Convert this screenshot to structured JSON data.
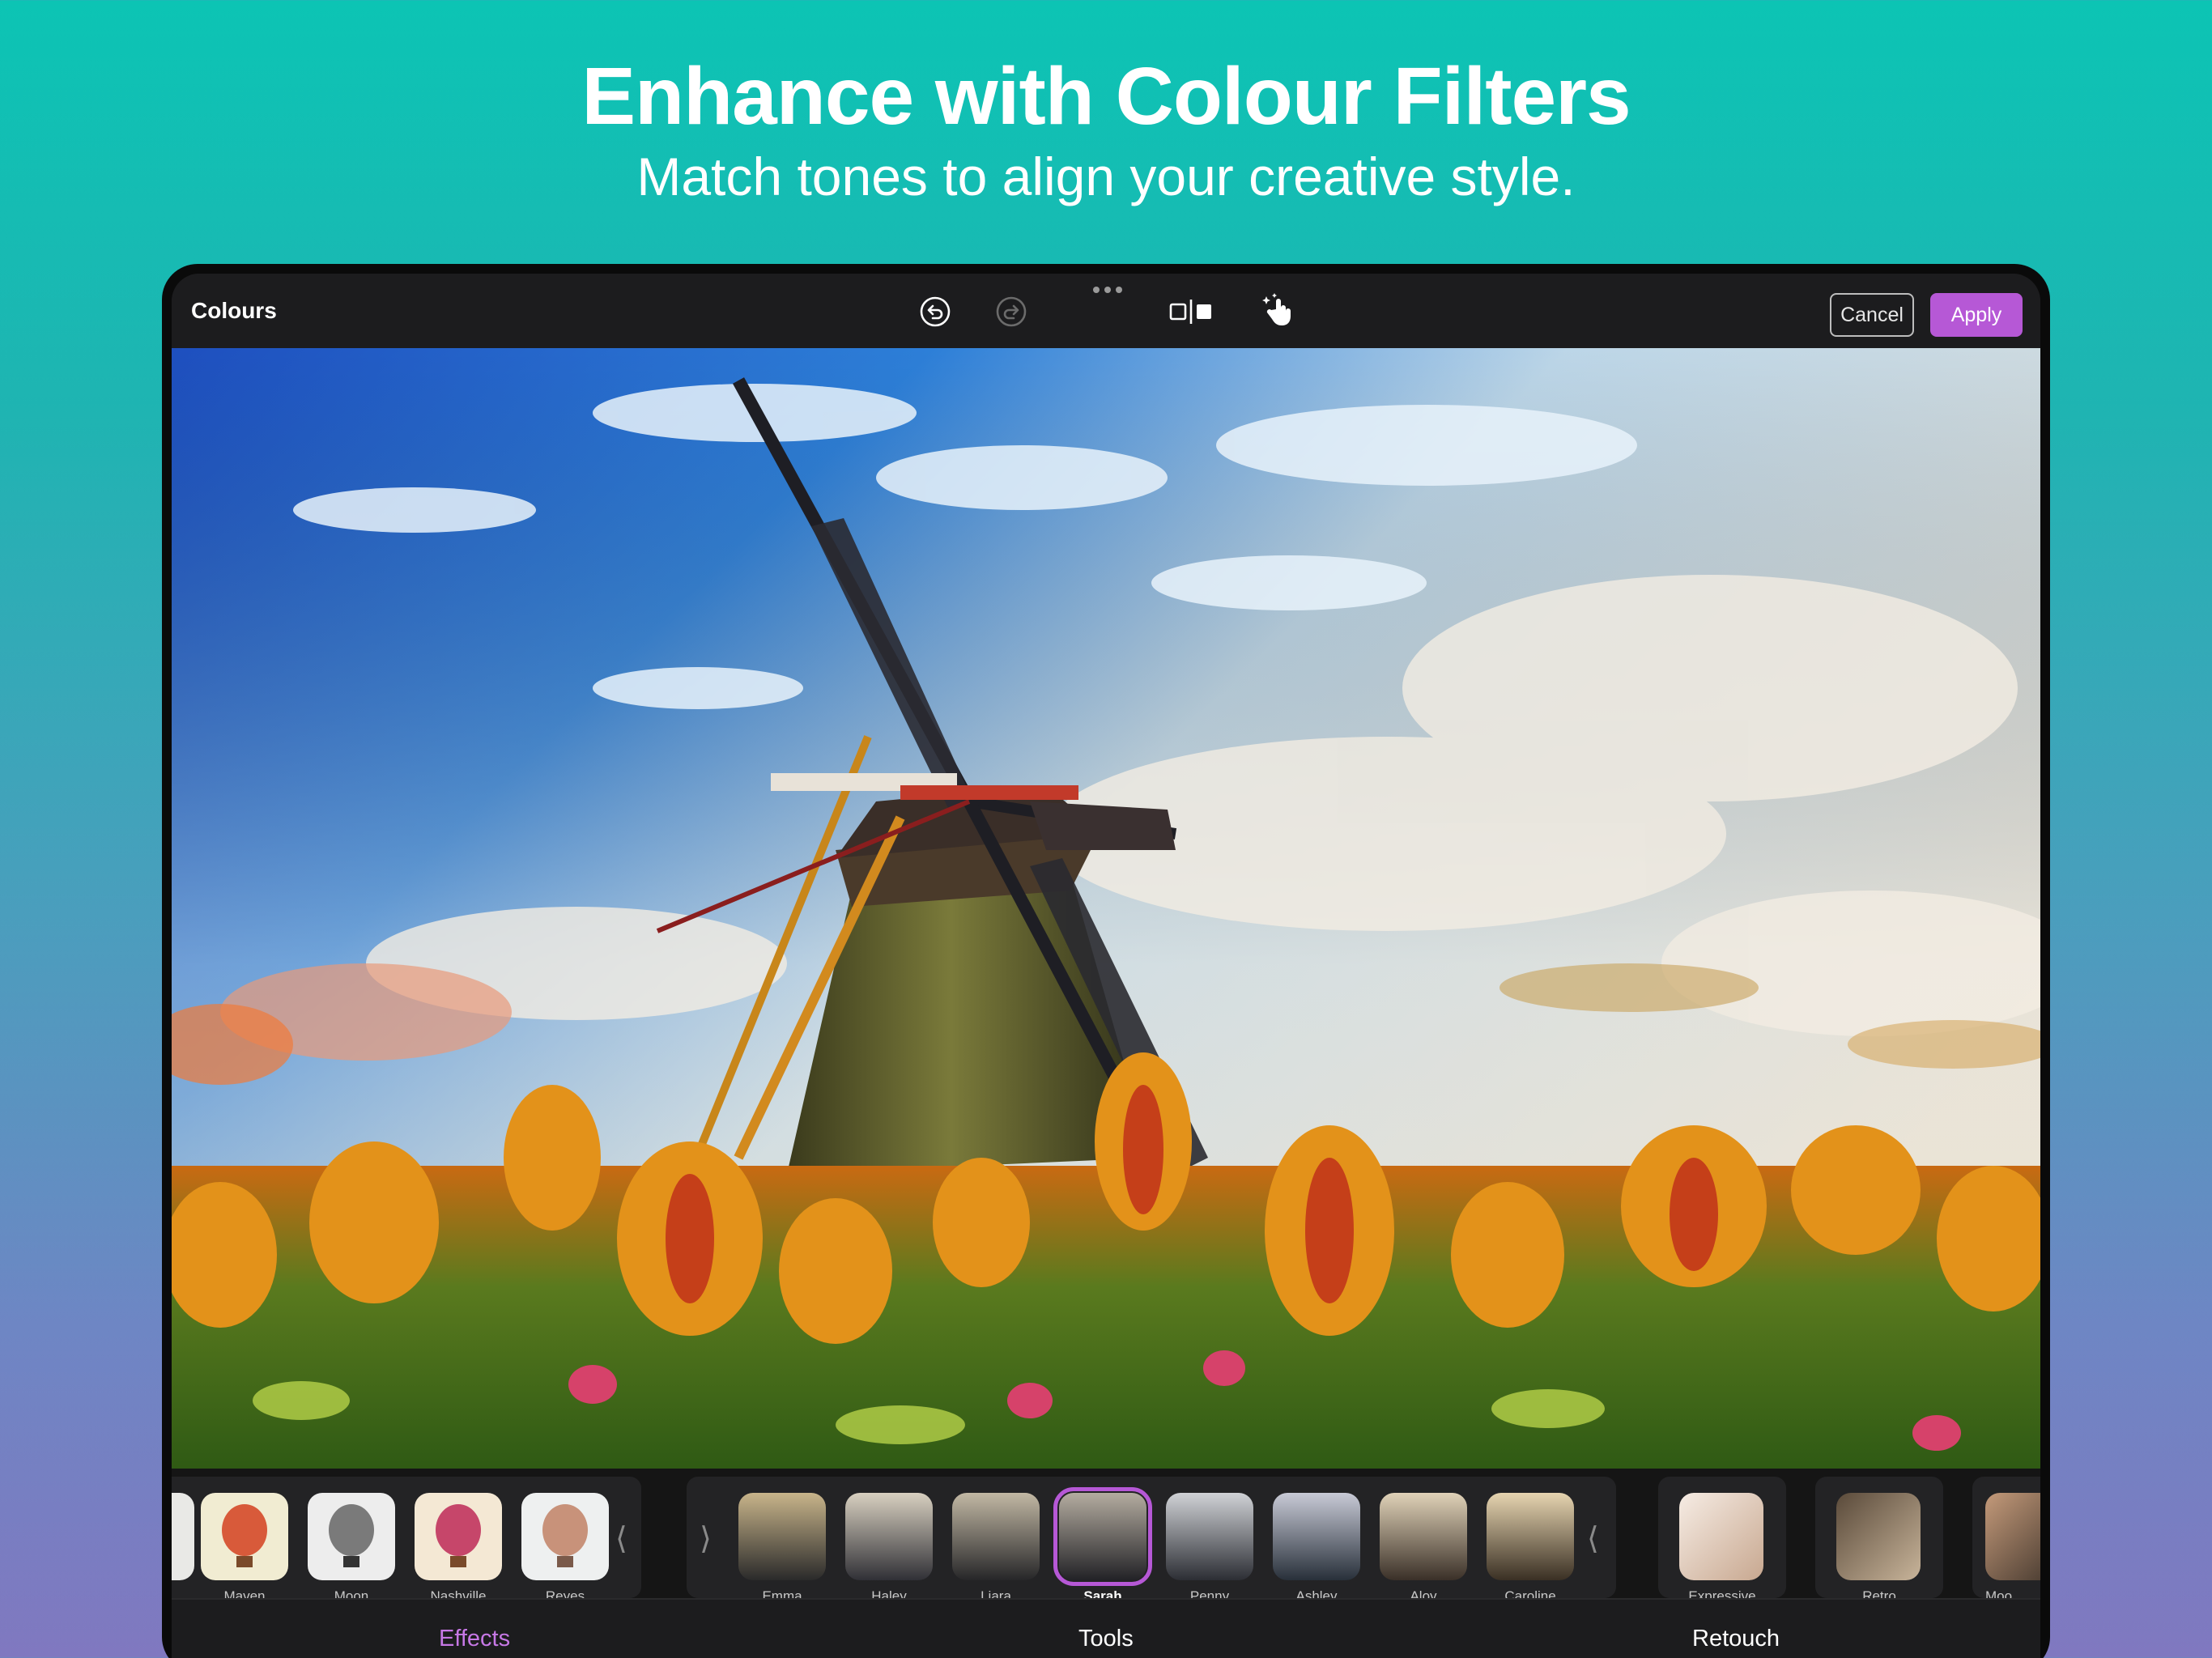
{
  "hero": {
    "title": "Enhance with Colour Filters",
    "subtitle": "Match tones to align your creative style."
  },
  "topbar": {
    "title": "Colours",
    "cancel_label": "Cancel",
    "apply_label": "Apply",
    "icons": [
      "undo-icon",
      "redo-icon",
      "more-dots-icon",
      "compare-icon",
      "magic-touch-icon"
    ]
  },
  "filters": {
    "group1": [
      {
        "label": "Maven"
      },
      {
        "label": "Moon"
      },
      {
        "label": "Nashville"
      },
      {
        "label": "Reyes"
      }
    ],
    "group2": [
      {
        "label": "Emma"
      },
      {
        "label": "Haley"
      },
      {
        "label": "Liara"
      },
      {
        "label": "Sarah",
        "selected": true
      },
      {
        "label": "Penny"
      },
      {
        "label": "Ashley"
      },
      {
        "label": "Aloy"
      },
      {
        "label": "Caroline"
      }
    ],
    "group3": [
      {
        "label": "Expressive"
      },
      {
        "label": "Retro"
      },
      {
        "label": "Moo"
      }
    ]
  },
  "tabs": {
    "effects": "Effects",
    "tools": "Tools",
    "retouch": "Retouch",
    "active": "Effects"
  },
  "colors": {
    "accent": "#b658d6",
    "background_top": "#0cc4b4",
    "background_bottom": "#8078c0"
  }
}
